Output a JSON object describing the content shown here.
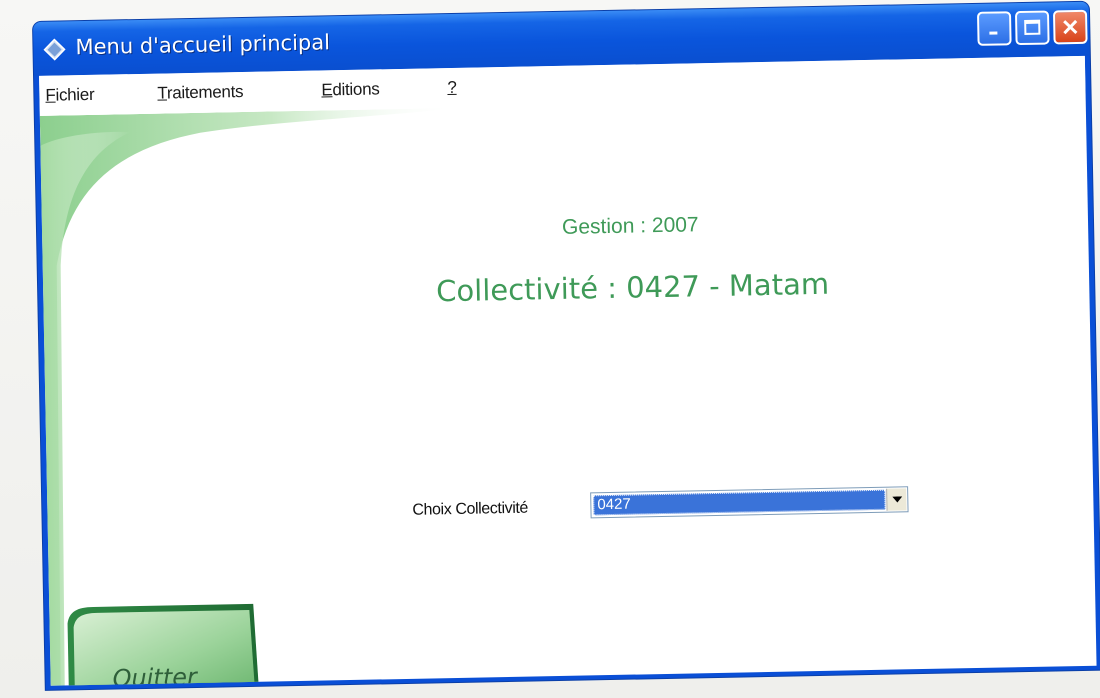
{
  "window": {
    "title": "Menu d'accueil principal",
    "icon": "application-diamond-icon"
  },
  "menu": {
    "items": [
      {
        "label": "Fichier",
        "accelerator": "F"
      },
      {
        "label": "Traitements",
        "accelerator": "T"
      },
      {
        "label": "Editions",
        "accelerator": "E"
      },
      {
        "label": "?",
        "accelerator": "?"
      }
    ]
  },
  "main": {
    "gestion": "Gestion : 2007",
    "collectivite": "Collectivité : 0427  -  Matam"
  },
  "form": {
    "choix_label": "Choix Collectivité",
    "choix_value": "0427"
  },
  "buttons": {
    "quit_label": "Quitter"
  },
  "colors": {
    "accent_green": "#3f9a58",
    "titlebar_blue": "#0a55dc",
    "selection_blue": "#3a73d9",
    "close_red": "#d8431a"
  }
}
